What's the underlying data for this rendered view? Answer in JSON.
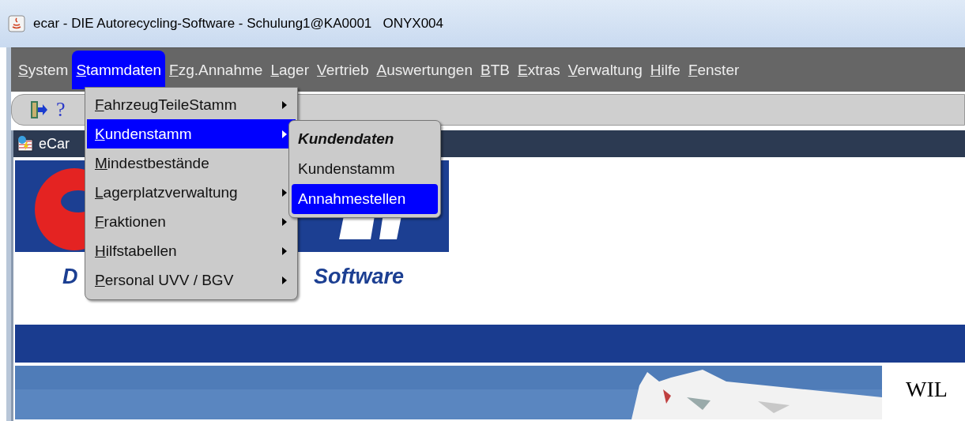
{
  "window": {
    "title": "ecar - DIE Autorecycling-Software - Schulung1@KA0001   ONYX004"
  },
  "menubar": [
    {
      "label": "System",
      "selected": false
    },
    {
      "label": "Stammdaten",
      "selected": true
    },
    {
      "label": "Fzg.Annahme",
      "selected": false
    },
    {
      "label": "Lager",
      "selected": false
    },
    {
      "label": "Vertrieb",
      "selected": false
    },
    {
      "label": "Auswertungen",
      "selected": false
    },
    {
      "label": "BTB",
      "selected": false
    },
    {
      "label": "Extras",
      "selected": false
    },
    {
      "label": "Verwaltung",
      "selected": false
    },
    {
      "label": "Hilfe",
      "selected": false
    },
    {
      "label": "Fenster",
      "selected": false
    }
  ],
  "toolbar": {
    "help_label": "?"
  },
  "dropdown": [
    {
      "label": "FahrzeugTeileStamm",
      "submenu": true,
      "selected": false
    },
    {
      "label": "Kundenstamm",
      "submenu": true,
      "selected": true
    },
    {
      "label": "Mindestbestände",
      "submenu": false,
      "selected": false
    },
    {
      "label": "Lagerplatzverwaltung",
      "submenu": true,
      "selected": false
    },
    {
      "label": "Fraktionen",
      "submenu": true,
      "selected": false
    },
    {
      "label": "Hilfstabellen",
      "submenu": true,
      "selected": false
    },
    {
      "label": "Personal UVV / BGV",
      "submenu": true,
      "selected": false
    }
  ],
  "submenu": [
    {
      "label": "Kundendaten",
      "kind": "heading",
      "selected": false
    },
    {
      "label": "Kundenstamm",
      "kind": "item",
      "selected": false
    },
    {
      "label": "Annahmestellen",
      "kind": "item",
      "selected": true
    }
  ],
  "inner_window": {
    "title": "eCar"
  },
  "content": {
    "tagline_start": "D",
    "tagline_end": "Software",
    "welcome": "WIL"
  }
}
